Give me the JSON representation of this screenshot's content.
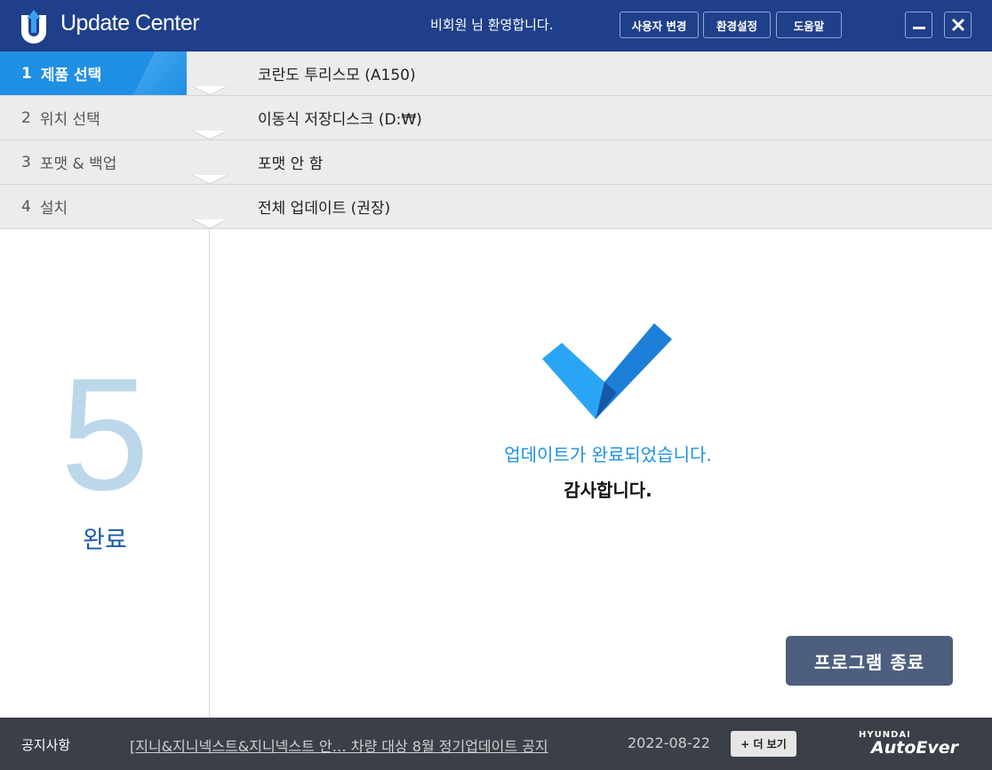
{
  "titlebar": {
    "app_title": "Update Center",
    "welcome": "비회원 님 환영합니다.",
    "buttons": {
      "change_user": "사용자 변경",
      "settings": "환경설정",
      "help": "도움말"
    },
    "colors": {
      "bar": "#1f3f8a",
      "accent": "#1f8fe4"
    }
  },
  "steps": [
    {
      "num": "1",
      "label": "제품 선택",
      "value": "코란도 투리스모 (A150)",
      "active": true
    },
    {
      "num": "2",
      "label": "위치 선택",
      "value": "이동식 저장디스크 (D:₩)",
      "active": false
    },
    {
      "num": "3",
      "label": "포맷 & 백업",
      "value": "포맷 안 함",
      "active": false
    },
    {
      "num": "4",
      "label": "설치",
      "value": "전체 업데이트 (권장)",
      "active": false
    }
  ],
  "left": {
    "step_number": "5",
    "step_label": "완료"
  },
  "main": {
    "icon": "check-icon",
    "message": "업데이트가 완료되었습니다.",
    "thanks": "감사합니다.",
    "exit_button": "프로그램 종료"
  },
  "footer": {
    "notice_label": "공지사항",
    "notice_text": "[지니&지니넥스트&지니넥스트  안… 차량 대상 8월 정기업데이트 공지",
    "notice_date": "2022-08-22",
    "more_button": "+ 더 보기",
    "brand_top": "HYUNDAI",
    "brand_bottom": "AutoEver"
  }
}
